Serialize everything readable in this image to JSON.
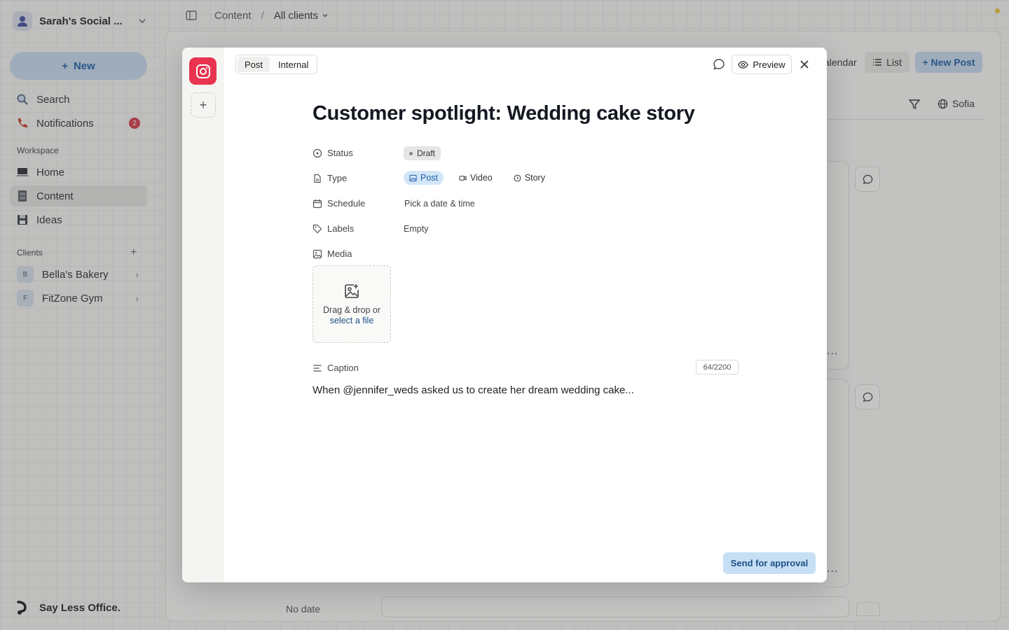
{
  "sidebar": {
    "workspace_name": "Sarah's Social ...",
    "new_label": "New",
    "search_label": "Search",
    "notifications_label": "Notifications",
    "notifications_count": "2",
    "workspace_section": "Workspace",
    "items": [
      {
        "label": "Home",
        "icon": "laptop-icon"
      },
      {
        "label": "Content",
        "icon": "cabinet-icon"
      },
      {
        "label": "Ideas",
        "icon": "floppy-icon"
      }
    ],
    "clients_section": "Clients",
    "clients": [
      {
        "initial": "B",
        "name": "Bella's Bakery"
      },
      {
        "initial": "F",
        "name": "FitZone Gym"
      }
    ],
    "brand": "Say Less Office."
  },
  "topbar": {
    "crumb_root": "Content",
    "crumb_separator": "/",
    "crumb_current": "All clients"
  },
  "background": {
    "calendar_label": "alendar",
    "list_label": "List",
    "new_post_label": "+ New Post",
    "sofia_label": "Sofia",
    "dots": "...",
    "no_date": "No date"
  },
  "modal": {
    "toggle": {
      "post": "Post",
      "internal": "Internal"
    },
    "preview_label": "Preview",
    "title": "Customer spotlight: Wedding cake story",
    "props": {
      "status_label": "Status",
      "status_value": "Draft",
      "type_label": "Type",
      "type_options": [
        "Post",
        "Video",
        "Story"
      ],
      "schedule_label": "Schedule",
      "schedule_placeholder": "Pick a date & time",
      "labels_label": "Labels",
      "labels_value": "Empty",
      "media_label": "Media"
    },
    "dropzone": {
      "line1": "Drag & drop or",
      "link": "select a file"
    },
    "caption_label": "Caption",
    "caption_counter": "64/2200",
    "caption_text": "When @jennifer_weds asked us to create her dream wedding cake...",
    "send_label": "Send for approval"
  },
  "colors": {
    "accent": "#1f5fa6",
    "accent_soft": "#c6d9ee",
    "instagram": "#e8344e",
    "badge": "#d33a4a"
  }
}
